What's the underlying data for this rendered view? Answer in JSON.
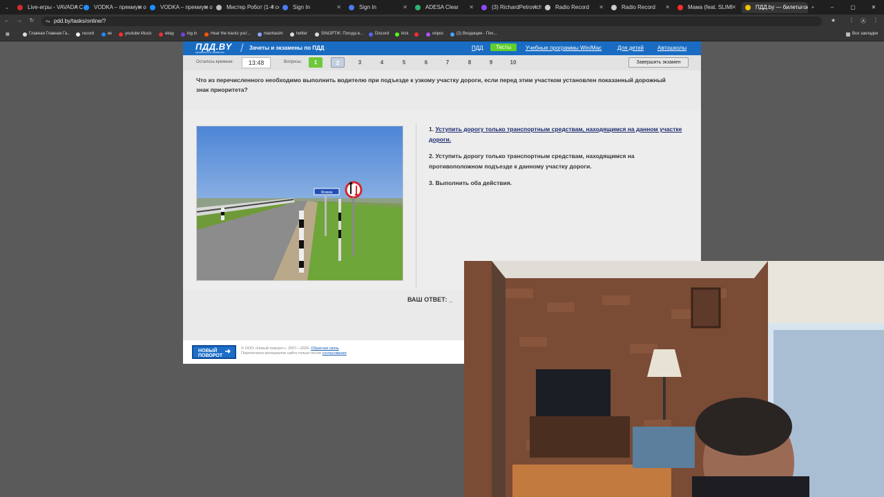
{
  "browser": {
    "tabs": [
      {
        "label": "Live-игры - VAVADA C",
        "color": "#d12b2b"
      },
      {
        "label": "VODKA – премиум он",
        "color": "#1e90ff"
      },
      {
        "label": "VODKA – премиум он",
        "color": "#1e90ff"
      },
      {
        "label": "Мистер Робот (1-4 се",
        "color": "#bbbbbb"
      },
      {
        "label": "Sign In",
        "color": "#4a7cf0"
      },
      {
        "label": "Sign In",
        "color": "#4a7cf0"
      },
      {
        "label": "ADESA Clear",
        "color": "#2bb673"
      },
      {
        "label": "(3) RichardPetrovich -",
        "color": "#9146ff"
      },
      {
        "label": "Radio Record",
        "color": "#cccccc"
      },
      {
        "label": "Radio Record",
        "color": "#cccccc"
      },
      {
        "label": "Мама (feat. SLIMI",
        "color": "#ff2d2d"
      },
      {
        "label": "ПДД.by — билеты он",
        "color": "#f2c200"
      }
    ],
    "url": "pdd.by/tasks/online/?",
    "bookmarks": [
      {
        "label": "Главная Главная Га...",
        "color": "#dddddd"
      },
      {
        "label": "record",
        "color": "#eeeeee"
      },
      {
        "label": "вк",
        "color": "#2787f5"
      },
      {
        "label": "youtube Music",
        "color": "#ff2d2d"
      },
      {
        "label": "ebay",
        "color": "#e53238"
      },
      {
        "label": "log in",
        "color": "#7b3fe4"
      },
      {
        "label": "Hear the tracks you'...",
        "color": "#ff5500"
      },
      {
        "label": "manhasim",
        "color": "#8aa4ff"
      },
      {
        "label": "twitter",
        "color": "#dddddd"
      },
      {
        "label": "SINOPTIK: Погода в...",
        "color": "#dddddd"
      },
      {
        "label": "Discord",
        "color": "#5865f2"
      },
      {
        "label": "kick",
        "color": "#53fc18"
      },
      {
        "label": "",
        "color": "#ff2d2d"
      },
      {
        "label": "опрос",
        "color": "#a855f7"
      },
      {
        "label": "(2) Входящие - Поч...",
        "color": "#4aa3ff"
      }
    ],
    "all_bookmarks": "Все закладки"
  },
  "site": {
    "logo": "ПДД.BY",
    "tagline": "правильно о правилах",
    "section": "Зачеты и экзамены по ПДД",
    "nav": [
      "ПДД",
      "Тесты",
      "Учебные программы Win/Mac",
      "Для детей",
      "Автошколы"
    ],
    "time_label": "Осталось времени:",
    "timer": "13:48",
    "questions_label": "Вопросы:",
    "questions": [
      "1",
      "2",
      "3",
      "4",
      "5",
      "6",
      "7",
      "8",
      "9",
      "10"
    ],
    "finish": "Завершить экзамен",
    "question": "Что из перечисленного необходимо выполнить водителю при подъезде к узкому участку дороги, если перед этим участком установлен показанный дорожный знак приоритета?",
    "answers": [
      {
        "num": "1.",
        "text": "Уступить дорогу только транспортным средствам, находящимся на данном участке дороги."
      },
      {
        "num": "2.",
        "text": "Уступить дорогу только транспортным средствам, находящимся на противоположном подъезде к данному участку дороги."
      },
      {
        "num": "3.",
        "text": "Выполнить оба действия."
      }
    ],
    "sign_text": "Жожма",
    "your_answer": "ВАШ ОТВЕТ:",
    "your_answer_value": "_",
    "footer_logo_1": "НОВЫЙ",
    "footer_logo_2": "ПОВОРОТ",
    "copyright": "© ООО «Новый поворот», 2007—2026.",
    "feedback": "Обратная связь",
    "reprint": "Перепечатка материалов сайта только после",
    "agreement": "согласования"
  }
}
